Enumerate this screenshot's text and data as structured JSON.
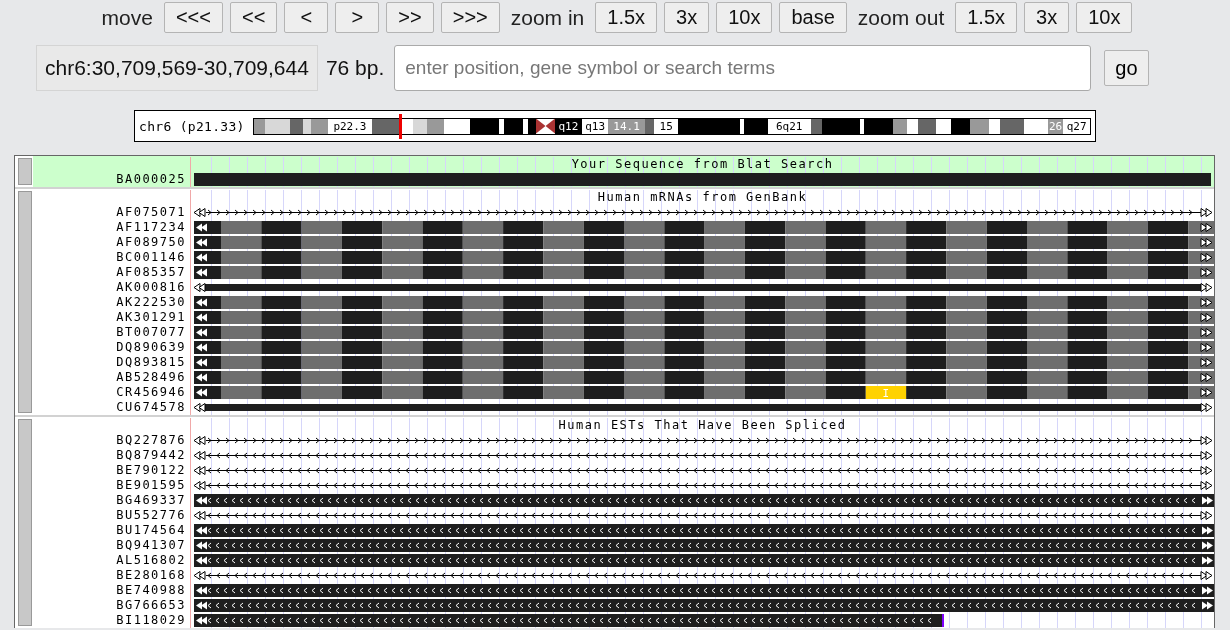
{
  "nav": {
    "move_label": "move",
    "move_buttons": [
      "<<<",
      "<<",
      "<",
      ">",
      ">>",
      ">>>"
    ],
    "zoom_in_label": "zoom in",
    "zoom_in_buttons": [
      "1.5x",
      "3x",
      "10x",
      "base"
    ],
    "zoom_out_label": "zoom out",
    "zoom_out_buttons": [
      "1.5x",
      "3x",
      "10x"
    ]
  },
  "position": {
    "range": "chr6:30,709,569-30,709,644",
    "size": "76 bp.",
    "search": {
      "placeholder": "enter position, gene symbol or search terms"
    },
    "go_button": "go"
  },
  "ideogram": {
    "label": "chr6 (p21.33)",
    "bands": [
      {
        "kind": "gpos50"
      },
      {
        "kind": "gpos25"
      },
      {
        "kind": "gpos75"
      },
      {
        "kind": "gpos25"
      },
      {
        "kind": "gpos50"
      },
      {
        "kind": "gneg",
        "label": "p22.3"
      },
      {
        "kind": "gpos75"
      },
      {
        "kind": "marker"
      },
      {
        "kind": "gneg"
      },
      {
        "kind": "gpos25"
      },
      {
        "kind": "gpos50"
      },
      {
        "kind": "gneg"
      },
      {
        "kind": "gpos100"
      },
      {
        "kind": "gneg"
      },
      {
        "kind": "gpos100"
      },
      {
        "kind": "gneg"
      },
      {
        "kind": "gpos100"
      },
      {
        "kind": "acen-p"
      },
      {
        "kind": "acen-q"
      },
      {
        "kind": "gpos100",
        "label": "q12"
      },
      {
        "kind": "gneg",
        "label": "q13"
      },
      {
        "kind": "gpos50",
        "label": "14.1"
      },
      {
        "kind": "gpos75"
      },
      {
        "kind": "gneg",
        "label": "15"
      },
      {
        "kind": "gpos100"
      },
      {
        "kind": "gneg"
      },
      {
        "kind": "gpos100"
      },
      {
        "kind": "gneg",
        "label": "6q21"
      },
      {
        "kind": "gpos75"
      },
      {
        "kind": "gpos100"
      },
      {
        "kind": "gneg"
      },
      {
        "kind": "gpos100"
      },
      {
        "kind": "gpos50"
      },
      {
        "kind": "gneg"
      },
      {
        "kind": "gpos75"
      },
      {
        "kind": "gneg"
      },
      {
        "kind": "gpos100"
      },
      {
        "kind": "gpos50"
      },
      {
        "kind": "gneg"
      },
      {
        "kind": "gpos75"
      },
      {
        "kind": "gneg"
      },
      {
        "kind": "gpos50",
        "label": "26"
      },
      {
        "kind": "gneg",
        "label": "q27"
      }
    ]
  },
  "tracks": [
    {
      "title": "Your Sequence from Blat Search",
      "highlighted": true,
      "rows": [
        {
          "name": "BA000025",
          "kind": "solid"
        }
      ]
    },
    {
      "title": "Human mRNAs from GenBank",
      "highlighted": false,
      "rows": [
        {
          "name": "AF075071",
          "kind": "line-fwd"
        },
        {
          "name": "AF117234",
          "kind": "exons"
        },
        {
          "name": "AF089750",
          "kind": "exons"
        },
        {
          "name": "BC001146",
          "kind": "exons"
        },
        {
          "name": "AF085357",
          "kind": "exons"
        },
        {
          "name": "AK000816",
          "kind": "thick"
        },
        {
          "name": "AK222530",
          "kind": "exons"
        },
        {
          "name": "AK301291",
          "kind": "exons"
        },
        {
          "name": "BT007077",
          "kind": "exons"
        },
        {
          "name": "DQ890639",
          "kind": "exons"
        },
        {
          "name": "DQ893815",
          "kind": "exons"
        },
        {
          "name": "AB528496",
          "kind": "exons"
        },
        {
          "name": "CR456946",
          "kind": "exons",
          "insertion": {
            "text": "I"
          }
        },
        {
          "name": "CU674578",
          "kind": "thick"
        }
      ]
    },
    {
      "title": "Human ESTs That Have Been Spliced",
      "highlighted": false,
      "rows": [
        {
          "name": "BQ227876",
          "kind": "line-fwd"
        },
        {
          "name": "BQ879442",
          "kind": "line-rev"
        },
        {
          "name": "BE790122",
          "kind": "line-rev"
        },
        {
          "name": "BE901595",
          "kind": "line-rev"
        },
        {
          "name": "BG469337",
          "kind": "block"
        },
        {
          "name": "BU552776",
          "kind": "line-rev"
        },
        {
          "name": "BU174564",
          "kind": "block"
        },
        {
          "name": "BQ941307",
          "kind": "block"
        },
        {
          "name": "AL516802",
          "kind": "block"
        },
        {
          "name": "BE280168",
          "kind": "line-rev"
        },
        {
          "name": "BE740988",
          "kind": "block"
        },
        {
          "name": "BG766653",
          "kind": "block"
        },
        {
          "name": "BI118029",
          "kind": "partial",
          "level": 0.737
        }
      ]
    }
  ]
}
